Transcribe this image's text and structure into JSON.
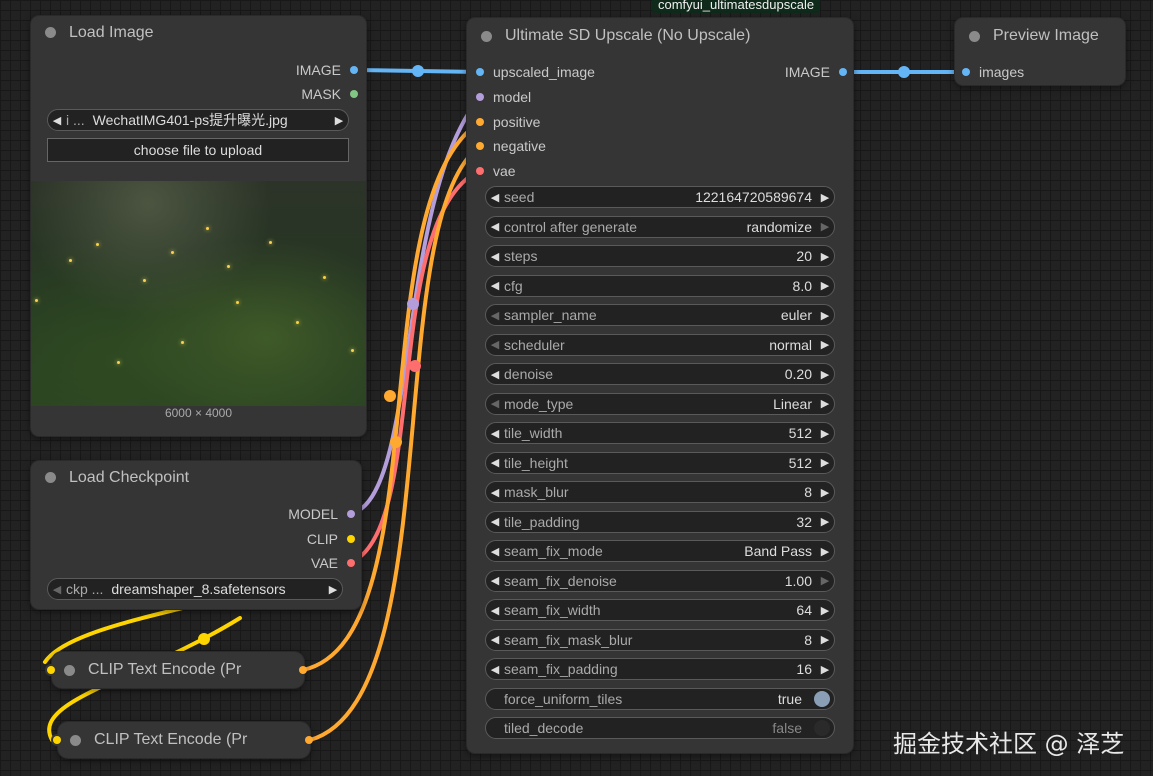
{
  "colors": {
    "image": "#64b5f6",
    "model": "#b39ddb",
    "clip": "#ffd500",
    "vae": "#ff6e6e",
    "conditioning": "#ffa931",
    "mask": "#81c784",
    "toggle_on": "#8a9fb5",
    "toggle_off": "#2a2a2a"
  },
  "floating_tag": "comfyui_ultimatesdupscale",
  "load_image": {
    "title": "Load Image",
    "outputs": [
      "IMAGE",
      "MASK"
    ],
    "file_prefix": "i ...",
    "file_name": "WechatIMG401-ps提升曝光.jpg",
    "upload_label": "choose file to upload",
    "dimensions": "6000 × 4000"
  },
  "load_checkpoint": {
    "title": "Load Checkpoint",
    "outputs": [
      "MODEL",
      "CLIP",
      "VAE"
    ],
    "ckpt_prefix": "ckp ...",
    "ckpt_name": "dreamshaper_8.safetensors"
  },
  "clip1": {
    "title": "CLIP Text Encode (Pr"
  },
  "clip2": {
    "title": "CLIP Text Encode (Pr"
  },
  "upscale": {
    "title": "Ultimate SD Upscale (No Upscale)",
    "inputs": [
      "upscaled_image",
      "model",
      "positive",
      "negative",
      "vae"
    ],
    "output": "IMAGE",
    "widgets": [
      {
        "label": "seed",
        "value": "122164720589674",
        "left_dim": false,
        "right_dim": false
      },
      {
        "label": "control after generate",
        "value": "randomize",
        "left_dim": false,
        "right_dim": true
      },
      {
        "label": "steps",
        "value": "20",
        "left_dim": false,
        "right_dim": false
      },
      {
        "label": "cfg",
        "value": "8.0",
        "left_dim": false,
        "right_dim": false
      },
      {
        "label": "sampler_name",
        "value": "euler",
        "left_dim": true,
        "right_dim": false
      },
      {
        "label": "scheduler",
        "value": "normal",
        "left_dim": true,
        "right_dim": false
      },
      {
        "label": "denoise",
        "value": "0.20",
        "left_dim": false,
        "right_dim": false
      },
      {
        "label": "mode_type",
        "value": "Linear",
        "left_dim": true,
        "right_dim": false
      },
      {
        "label": "tile_width",
        "value": "512",
        "left_dim": false,
        "right_dim": false
      },
      {
        "label": "tile_height",
        "value": "512",
        "left_dim": false,
        "right_dim": false
      },
      {
        "label": "mask_blur",
        "value": "8",
        "left_dim": false,
        "right_dim": false
      },
      {
        "label": "tile_padding",
        "value": "32",
        "left_dim": false,
        "right_dim": false
      },
      {
        "label": "seam_fix_mode",
        "value": "Band Pass",
        "left_dim": false,
        "right_dim": false
      },
      {
        "label": "seam_fix_denoise",
        "value": "1.00",
        "left_dim": false,
        "right_dim": true
      },
      {
        "label": "seam_fix_width",
        "value": "64",
        "left_dim": false,
        "right_dim": false
      },
      {
        "label": "seam_fix_mask_blur",
        "value": "8",
        "left_dim": false,
        "right_dim": false
      },
      {
        "label": "seam_fix_padding",
        "value": "16",
        "left_dim": false,
        "right_dim": false
      }
    ],
    "toggles": [
      {
        "label": "force_uniform_tiles",
        "value": "true",
        "on": true
      },
      {
        "label": "tiled_decode",
        "value": "false",
        "on": false
      }
    ]
  },
  "preview": {
    "title": "Preview Image",
    "input": "images"
  },
  "watermark": "掘金技术社区 @ 泽芝"
}
